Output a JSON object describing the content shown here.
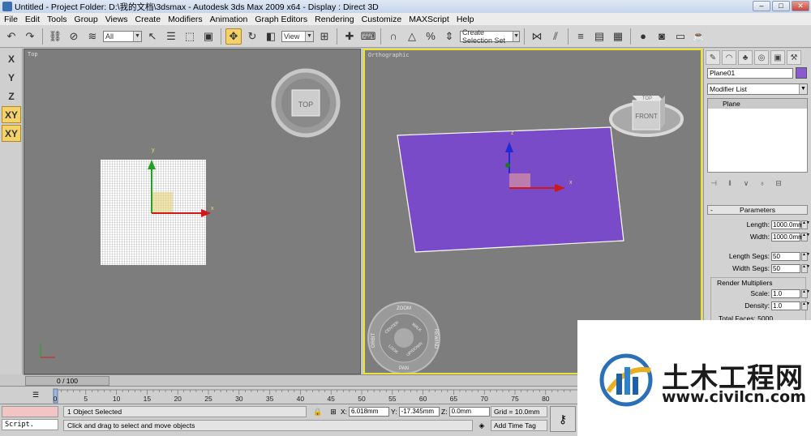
{
  "window": {
    "title": "Untitled    - Project Folder: D:\\我的文档\\3dsmax    - Autodesk 3ds Max  2009 x64     - Display : Direct 3D"
  },
  "menu": [
    "File",
    "Edit",
    "Tools",
    "Group",
    "Views",
    "Create",
    "Modifiers",
    "Animation",
    "Graph Editors",
    "Rendering",
    "Customize",
    "MAXScript",
    "Help"
  ],
  "toolbar": {
    "selection_filter": "All",
    "ref_coord": "View",
    "named_selection_placeholder": "Create Selection Set"
  },
  "axes": [
    "X",
    "Y",
    "Z",
    "XY",
    "XY"
  ],
  "viewports": {
    "left": {
      "label": "Top",
      "viewcube_label": "TOP",
      "gizmo_x": "x",
      "gizmo_y": "y"
    },
    "right": {
      "label": "Orthographic",
      "viewcube_top": "TOP",
      "viewcube_front": "FRONT",
      "gizmo_x": "x",
      "gizmo_z": "z",
      "wheel": [
        "ZOOM",
        "ORBIT",
        "CENTER",
        "WALK",
        "REWIND",
        "LOOK",
        "UP/DOWN",
        "PAN"
      ]
    }
  },
  "command_panel": {
    "object_name": "Plane01",
    "object_color": "#8a5ad0",
    "modifier_list": "Modifier List",
    "stack": [
      "Plane"
    ],
    "parameters_title": "Parameters",
    "params": [
      {
        "label": "Length:",
        "value": "1000.0mm"
      },
      {
        "label": "Width:",
        "value": "1000.0mm"
      },
      {
        "label": "Length Segs:",
        "value": "50"
      },
      {
        "label": "Width Segs:",
        "value": "50"
      }
    ],
    "render_group_title": "Render Multipliers",
    "render_params": [
      {
        "label": "Scale:",
        "value": "1.0"
      },
      {
        "label": "Density:",
        "value": "1.0"
      }
    ],
    "total_faces": "Total Faces: 5000"
  },
  "timeline": {
    "slider": "0 / 100",
    "ticks": [
      "0",
      "5",
      "10",
      "15",
      "20",
      "25",
      "30",
      "35",
      "40",
      "45",
      "50",
      "55",
      "60",
      "65",
      "70",
      "75",
      "80"
    ]
  },
  "status": {
    "script_label": "Script.",
    "selection": "1 Object Selected",
    "prompt": "Click and drag to select and move objects",
    "x_label": "X:",
    "x_value": "6.018mm",
    "y_label": "Y:",
    "y_value": "-17.345mm",
    "z_label": "Z:",
    "z_value": "0.0mm",
    "grid": "Grid = 10.0mm",
    "time_tag": "Add Time Tag"
  },
  "watermark": {
    "chinese": "土木工程网",
    "url": "www.civilcn.com"
  }
}
